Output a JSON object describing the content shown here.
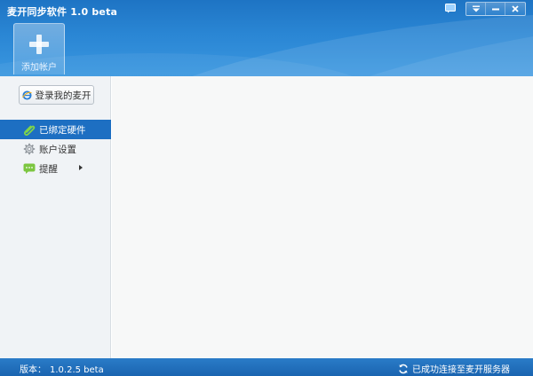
{
  "window": {
    "title": "麦开同步软件 1.0 beta",
    "controls": {
      "skin_icon": "skin-icon",
      "menu_icon": "menu-icon",
      "minimize_icon": "minimize-icon",
      "close_icon": "close-icon"
    }
  },
  "header": {
    "add_account_label": "添加帐户",
    "add_account_icon": "plus-icon"
  },
  "sidebar": {
    "login_button_label": "登录我的麦开",
    "login_button_icon": "ie-icon",
    "items": [
      {
        "label": "已绑定硬件",
        "icon": "paperclip-icon",
        "active": true
      },
      {
        "label": "账户设置",
        "icon": "gear-icon",
        "active": false
      },
      {
        "label": "提醒",
        "icon": "chat-icon",
        "active": false,
        "has_submenu": true
      }
    ]
  },
  "statusbar": {
    "version_label": "版本：",
    "version_value": "1.0.2.5 beta",
    "connection_text": "已成功连接至麦开服务器",
    "connection_icon": "sync-icon"
  },
  "colors": {
    "header_blue": "#2a86d4",
    "active_item": "#1d6fc2",
    "statusbar": "#1a64b0"
  }
}
